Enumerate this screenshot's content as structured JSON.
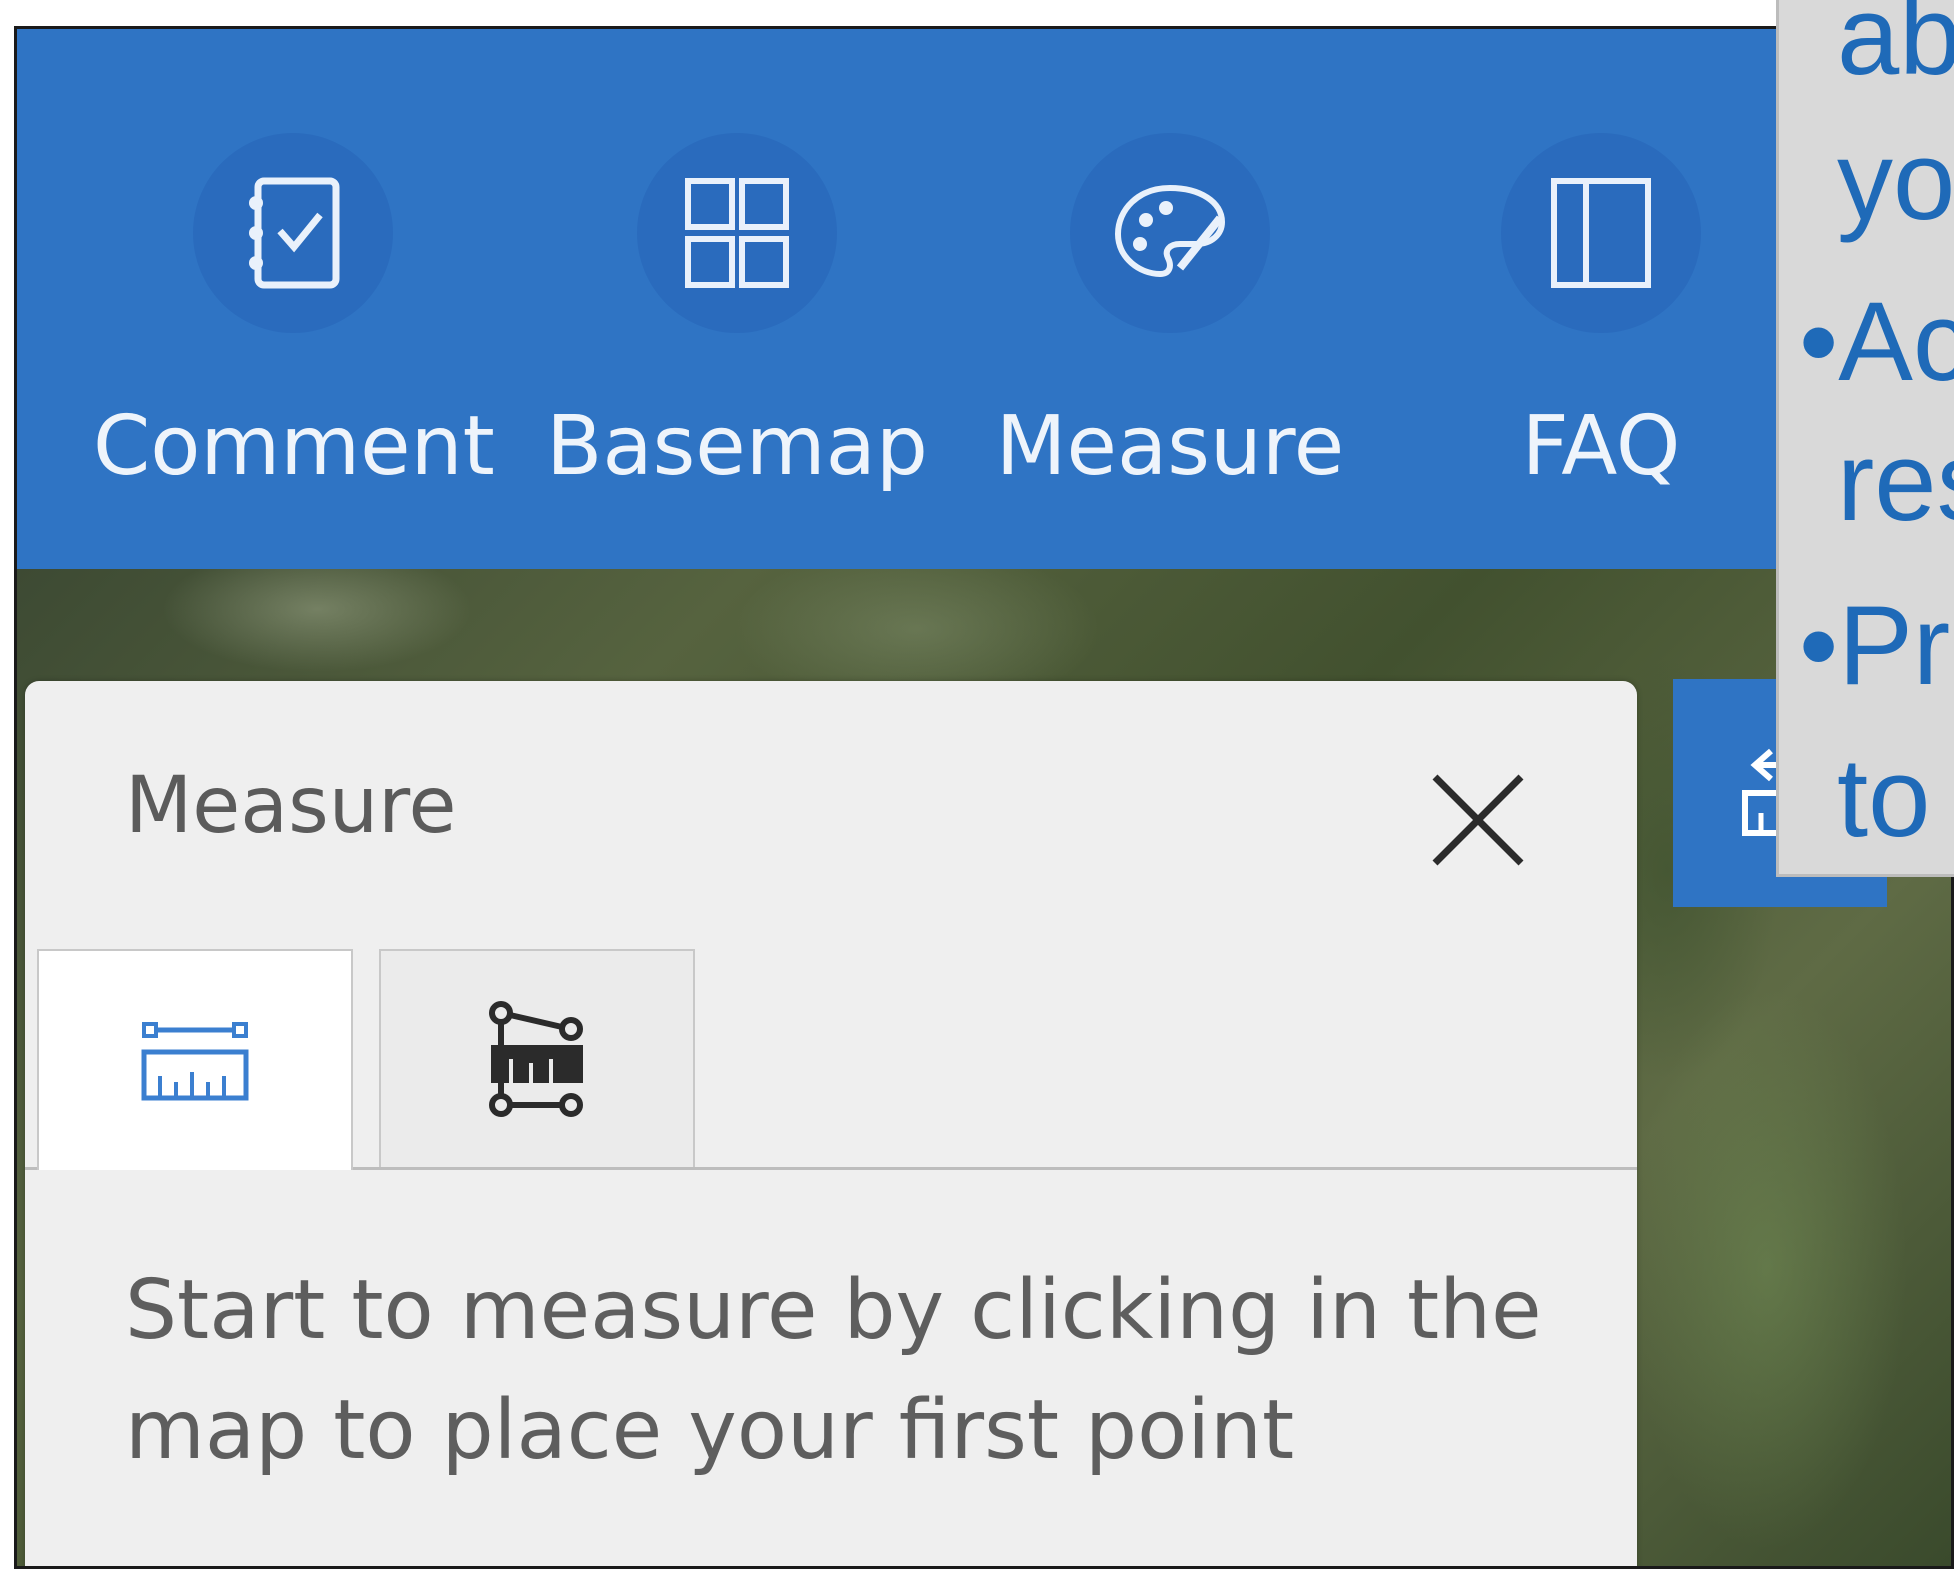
{
  "toolbar": {
    "tools": [
      {
        "label": "Comment",
        "icon": "checklist-icon"
      },
      {
        "label": "Basemap",
        "icon": "grid-icon"
      },
      {
        "label": "Measure",
        "icon": "palette-icon"
      },
      {
        "label": "FAQ",
        "icon": "panel-icon"
      }
    ]
  },
  "panel": {
    "title": "Measure",
    "close_icon": "close-icon",
    "tabs": [
      {
        "icon": "distance-ruler-icon",
        "active": true
      },
      {
        "icon": "area-ruler-icon",
        "active": false
      }
    ],
    "instructions": "Start to measure by clicking in the map to place your first point"
  },
  "side_button": {
    "icon": "collapse-measure-icon"
  },
  "overlay": {
    "lines": [
      "ab",
      "yo",
      "•Ac",
      "res",
      "•Pr",
      "to"
    ]
  },
  "colors": {
    "toolbar": "#2f74c4",
    "accent": "#1f6ab8",
    "panel_bg": "#efefef"
  }
}
